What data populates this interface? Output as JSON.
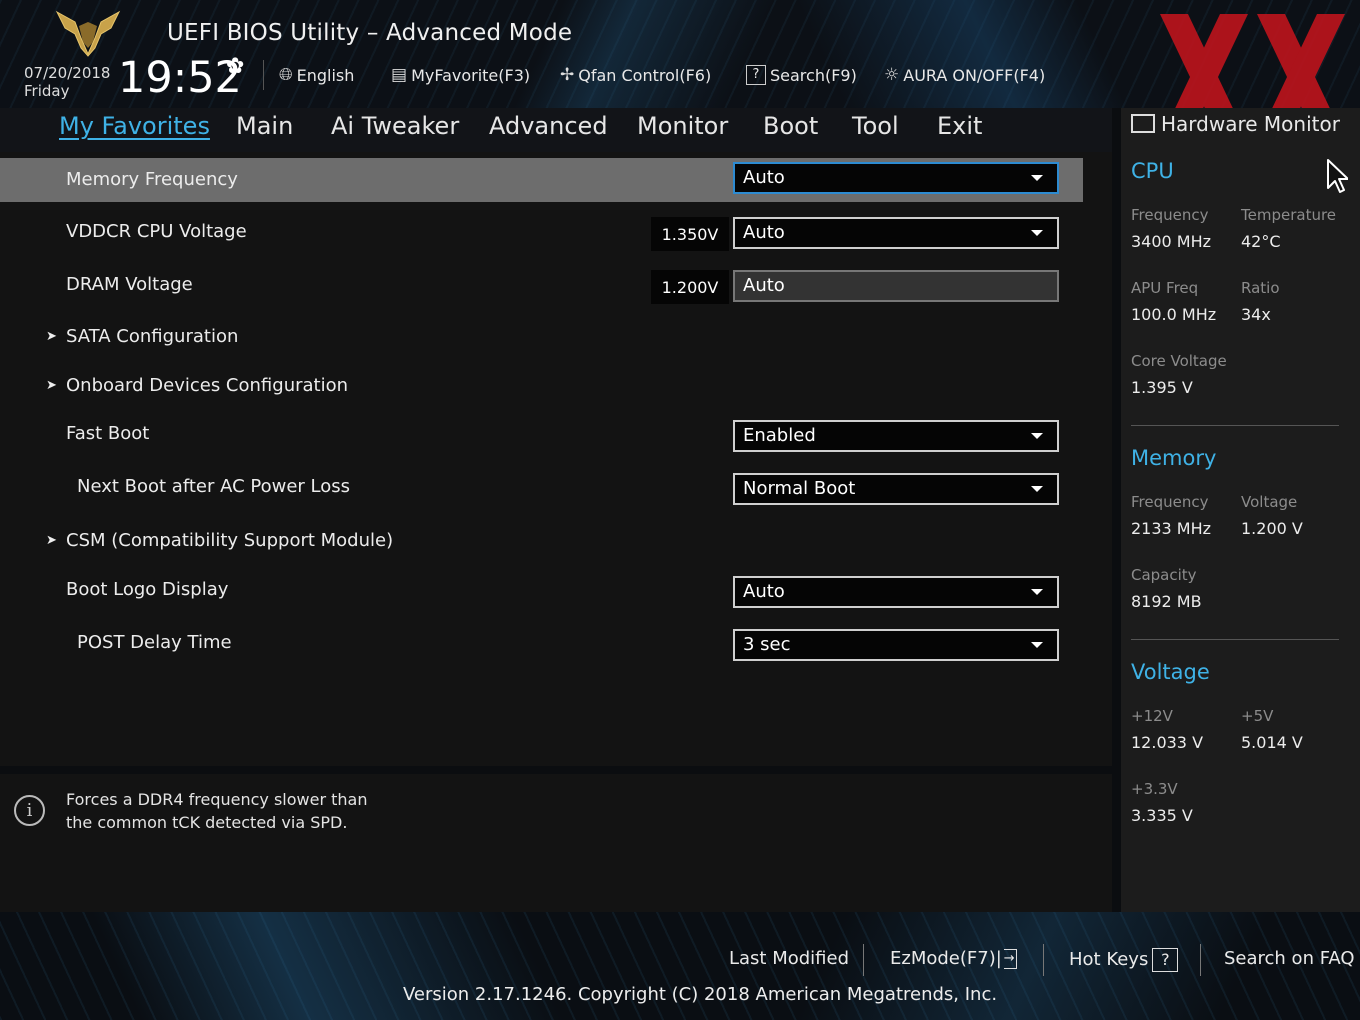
{
  "header": {
    "title": "UEFI BIOS Utility – Advanced Mode",
    "date": "07/20/2018",
    "day": "Friday",
    "time": "19:52",
    "toolbar": [
      {
        "label": "English",
        "icon": "globe-icon"
      },
      {
        "label": "MyFavorite(F3)",
        "icon": "favorites-icon"
      },
      {
        "label": "Qfan Control(F6)",
        "icon": "fan-icon"
      },
      {
        "label": "Search(F9)",
        "icon": "help-search-icon"
      },
      {
        "label": "AURA ON/OFF(F4)",
        "icon": "aura-light-icon"
      }
    ]
  },
  "tabs": [
    "My Favorites",
    "Main",
    "Ai Tweaker",
    "Advanced",
    "Monitor",
    "Boot",
    "Tool",
    "Exit"
  ],
  "active_tab": "My Favorites",
  "settings": [
    {
      "label": "Memory Frequency",
      "value": "Auto",
      "selected": true
    },
    {
      "label": "VDDCR CPU Voltage",
      "current": "1.350V",
      "value": "Auto"
    },
    {
      "label": "DRAM Voltage",
      "current": "1.200V",
      "value": "Auto"
    },
    {
      "label": "SATA Configuration",
      "submenu": true
    },
    {
      "label": "Onboard Devices Configuration",
      "submenu": true
    },
    {
      "label": "Fast Boot",
      "value": "Enabled"
    },
    {
      "label": "Next Boot after AC Power Loss",
      "value": "Normal Boot"
    },
    {
      "label": "CSM (Compatibility Support Module)",
      "submenu": true
    },
    {
      "label": "Boot Logo Display",
      "value": "Auto"
    },
    {
      "label": "POST Delay Time",
      "value": "3 sec"
    }
  ],
  "help": {
    "line1": "Forces a DDR4 frequency slower than",
    "line2": "the common tCK detected via SPD."
  },
  "hardware_monitor": {
    "title": "Hardware Monitor",
    "cpu": {
      "heading": "CPU",
      "frequency_label": "Frequency",
      "frequency": "3400 MHz",
      "temperature_label": "Temperature",
      "temperature": "42°C",
      "apu_label": "APU Freq",
      "apu": "100.0 MHz",
      "ratio_label": "Ratio",
      "ratio": "34x",
      "core_voltage_label": "Core Voltage",
      "core_voltage": "1.395 V"
    },
    "memory": {
      "heading": "Memory",
      "frequency_label": "Frequency",
      "frequency": "2133 MHz",
      "voltage_label": "Voltage",
      "voltage": "1.200 V",
      "capacity_label": "Capacity",
      "capacity": "8192 MB"
    },
    "voltage": {
      "heading": "Voltage",
      "v12_label": "+12V",
      "v12": "12.033 V",
      "v5_label": "+5V",
      "v5": "5.014 V",
      "v33_label": "+3.3V",
      "v33": "3.335 V"
    }
  },
  "footer": {
    "last_modified": "Last Modified",
    "ezmode": "EzMode(F7)|",
    "hotkeys": "Hot Keys",
    "hotkeys_key": "?",
    "faq": "Search on FAQ",
    "version": "Version 2.17.1246. Copyright (C) 2018 American Megatrends, Inc."
  },
  "colors": {
    "accent": "#3fb2e6",
    "selected_row": "#6d6d6d",
    "watermark": "#c8141c"
  }
}
